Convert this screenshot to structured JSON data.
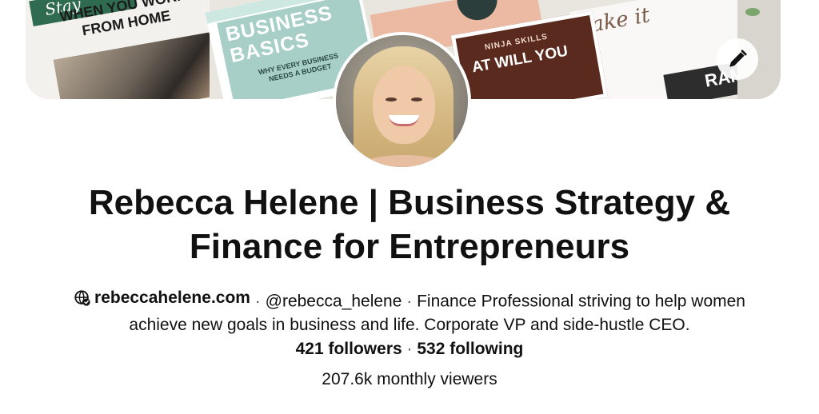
{
  "cover": {
    "tiles": {
      "tile1_script": "Stay",
      "tile1_headline": "WHEN YOU WORK FROM HOME",
      "tile2_title": "BUSINESS BASICS",
      "tile2_subtitle": "WHY EVERY BUSINESS NEEDS A BUDGET",
      "tile4_small": "NINJA SKILLS",
      "tile4_big": "AT WILL YOU",
      "tile5_script": "ake it",
      "tile6_text": "RAM"
    },
    "edit_icon": "pencil-icon"
  },
  "profile": {
    "name_line1": "Rebecca Helene | Business Strategy &",
    "name_line2": "Finance for Entrepreneurs",
    "website_icon": "verified-globe-icon",
    "website": "rebeccahelene.com",
    "separator": "·",
    "handle": "@rebecca_helene",
    "bio_part1": "Finance Professional striving to help women",
    "bio_part2": "achieve new goals in business and life. Corporate VP and side-hustle CEO.",
    "followers": "421 followers",
    "following": "532 following",
    "monthly_viewers": "207.6k monthly viewers"
  }
}
